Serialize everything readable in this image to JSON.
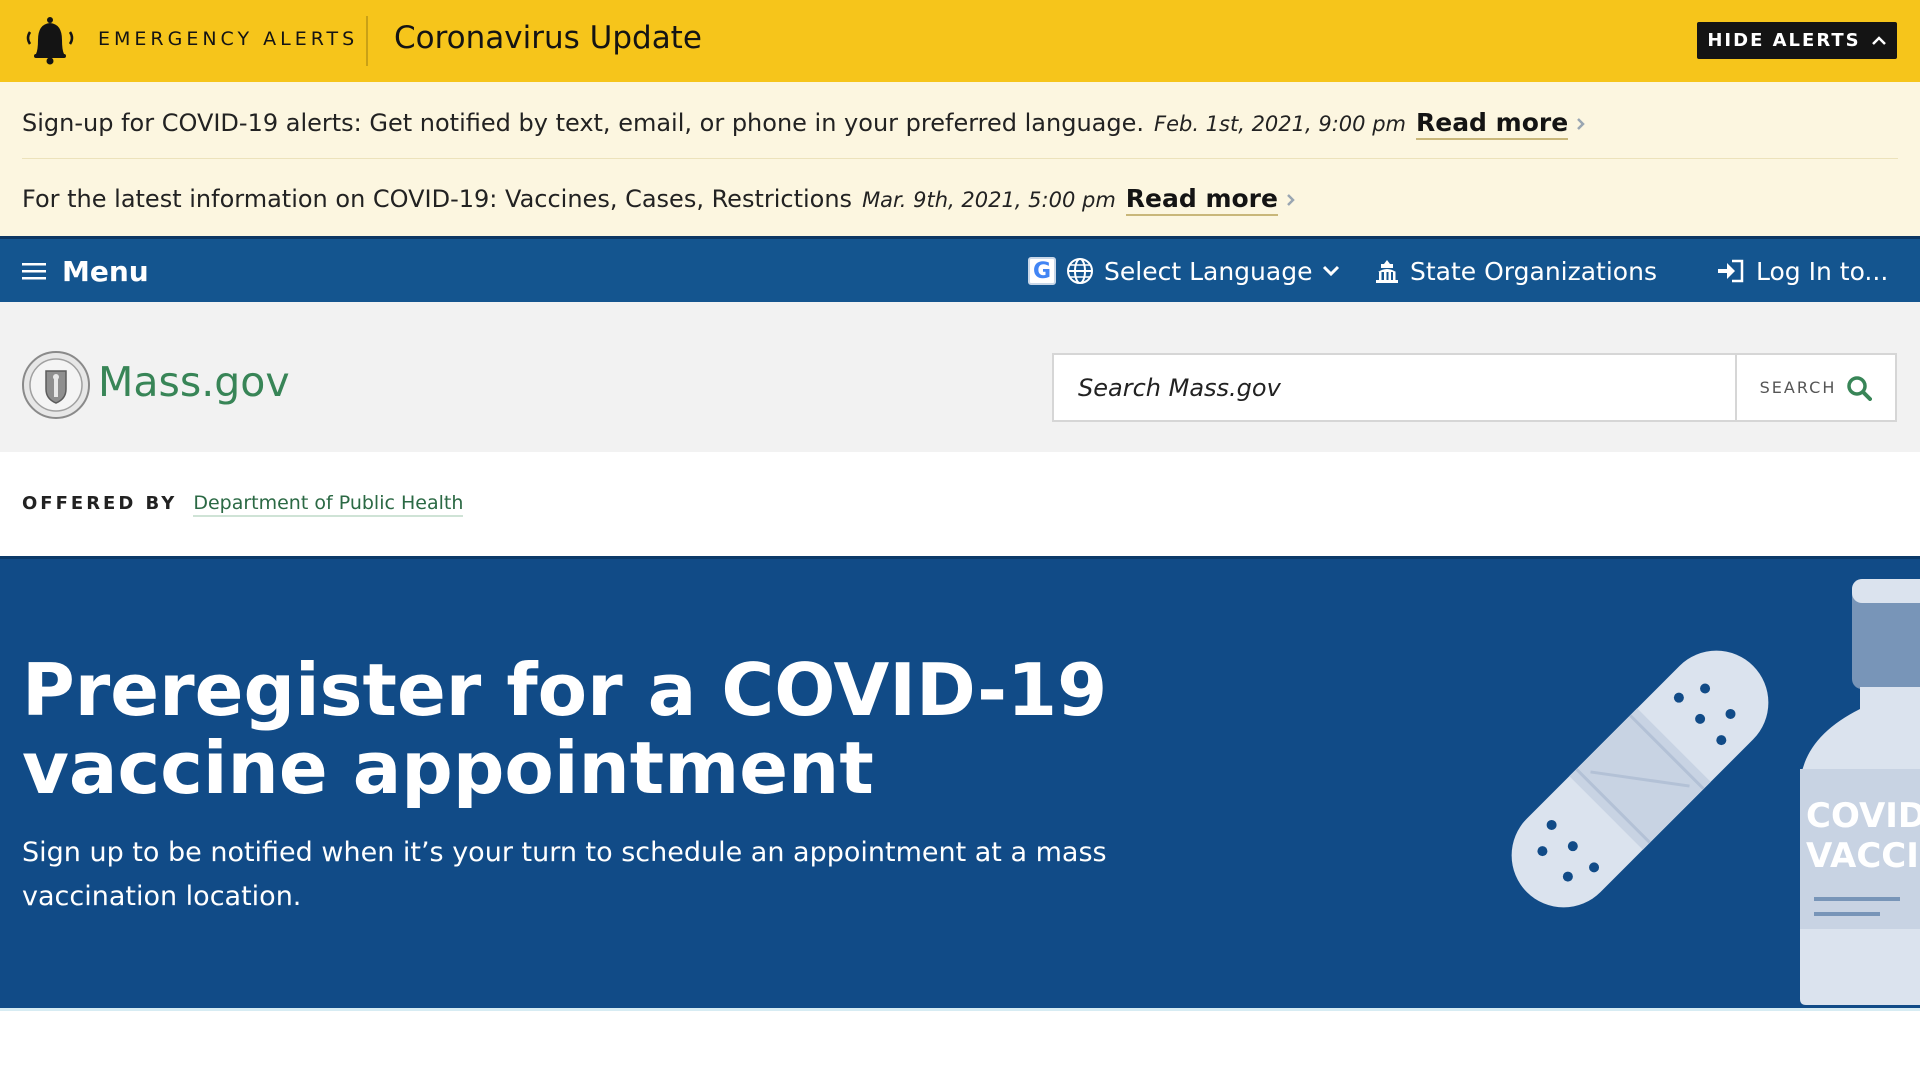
{
  "alert_bar": {
    "kicker": "EMERGENCY ALERTS",
    "title": "Coronavirus Update",
    "hide_label": "HIDE ALERTS"
  },
  "alerts": [
    {
      "text": "Sign-up for COVID-19 alerts: Get notified by text, email, or phone in your preferred language.",
      "date": "Feb. 1st, 2021, 9:00 pm",
      "link": "Read more"
    },
    {
      "text": "For the latest information on COVID-19: Vaccines, Cases, Restrictions",
      "date": "Mar. 9th, 2021, 5:00 pm",
      "link": "Read more"
    }
  ],
  "utility_nav": {
    "menu_label": "Menu",
    "google_badge": "G",
    "language_label": "Select Language",
    "state_orgs_label": "State Organizations",
    "login_label": "Log In to..."
  },
  "header": {
    "brand": "Mass.gov",
    "search_placeholder": "Search Mass.gov",
    "search_button": "SEARCH"
  },
  "offered_by": {
    "label": "OFFERED BY",
    "org": "Department of Public Health"
  },
  "hero": {
    "title": "Preregister for a COVID-19 vaccine appointment",
    "subtitle": "Sign up to be notified when it’s your turn to schedule an appointment at a mass vaccination location.",
    "vial_label_1": "COVID-",
    "vial_label_2": "VACCIN"
  },
  "colors": {
    "alert_yellow": "#f6c51b",
    "alert_cream": "#fcf6e0",
    "nav_blue": "#14558f",
    "hero_blue": "#114b87",
    "brand_green": "#388557"
  }
}
